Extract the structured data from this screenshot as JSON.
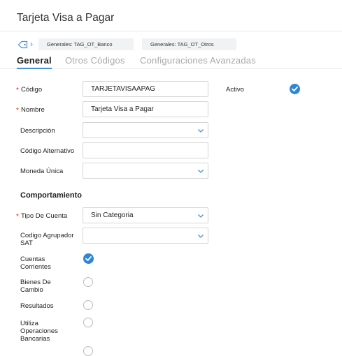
{
  "window": {
    "title": "Tarjeta Visa a Pagar"
  },
  "tags": [
    {
      "label": "Generales: TAG_OT_Banco"
    },
    {
      "label": "Generales: TAG_OT_Otros"
    }
  ],
  "tabs": [
    {
      "label": "General",
      "active": true
    },
    {
      "label": "Otros Códigos",
      "active": false
    },
    {
      "label": "Configuraciones Avanzadas",
      "active": false
    }
  ],
  "form": {
    "codigo": {
      "label": "Código",
      "required": true,
      "value": "TARJETAVISAAPAG"
    },
    "activo": {
      "label": "Activo",
      "checked": true
    },
    "nombre": {
      "label": "Nombre",
      "required": true,
      "value": "Tarjeta Visa a Pagar"
    },
    "descripcion": {
      "label": "Descripción",
      "value": ""
    },
    "codigo_alternativo": {
      "label": "Código Alternativo",
      "value": ""
    },
    "moneda_unica": {
      "label": "Moneda Única",
      "value": ""
    }
  },
  "comportamiento": {
    "title": "Comportamiento",
    "tipo_de_cuenta": {
      "label": "Tipo De Cuenta",
      "required": true,
      "value": "Sin Categoria"
    },
    "codigo_agrupador_sat": {
      "label_line1": "Codigo Agrupador",
      "label_line2": "SAT",
      "value": ""
    },
    "cuentas_corrientes": {
      "label_line1": "Cuentas",
      "label_line2": "Corrientes",
      "checked": true
    },
    "bienes_de_cambio": {
      "label_line1": "Bienes De",
      "label_line2": "Cambio",
      "checked": false
    },
    "resultados": {
      "label": "Resultados",
      "checked": false
    },
    "utiliza_operaciones_bancarias": {
      "label_line1": "Utiliza",
      "label_line2": "Operaciones",
      "label_line3": "Bancarias",
      "checked": false
    }
  },
  "colors": {
    "accent": "#2f86d6",
    "required": "#e0342b",
    "tab_inactive": "#aaaaaa"
  },
  "icons": {
    "tag": "tag-icon",
    "chevron": "chevron-right-icon",
    "dropdown": "chevron-down-icon",
    "check": "check-circle-icon"
  }
}
